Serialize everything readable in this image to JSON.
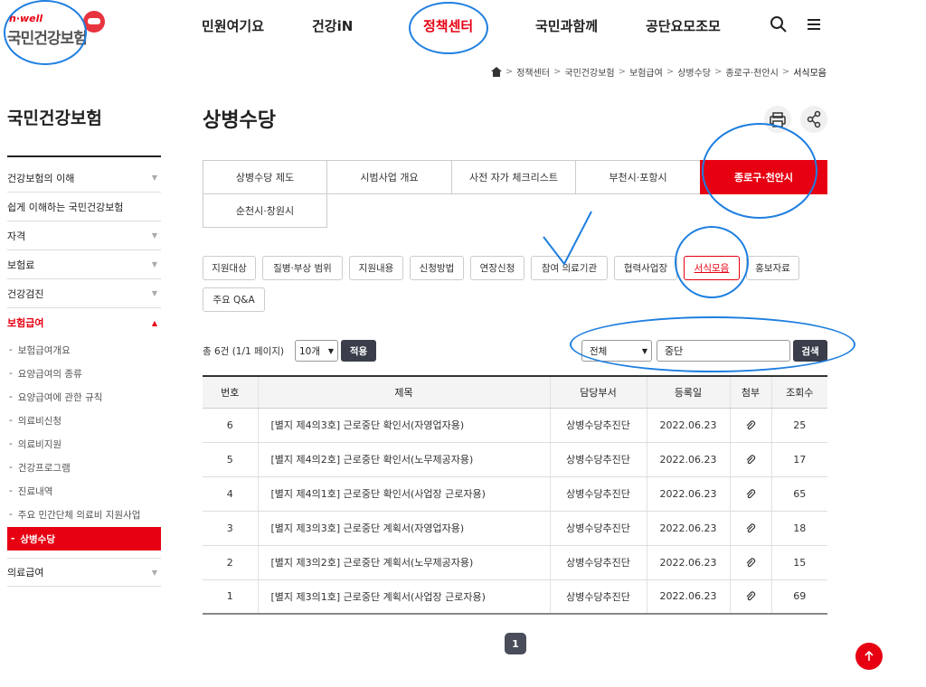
{
  "header": {
    "logo_sub": "h·well",
    "logo_text": "국민건강보험",
    "nav": [
      "민원여기요",
      "건강iN",
      "정책센터",
      "국민과함께",
      "공단요모조모"
    ]
  },
  "breadcrumb": [
    "정책센터",
    "국민건강보험",
    "보험급여",
    "상병수당",
    "종로구·천안시",
    "서식모음"
  ],
  "sidebar": {
    "title": "국민건강보험",
    "items": [
      "건강보험의 이해",
      "쉽게 이해하는 국민건강보험",
      "자격",
      "보험료",
      "건강검진",
      "보험급여"
    ],
    "sub_items": [
      "보험급여개요",
      "요양급여의 종류",
      "요양급여에 관한 규칙",
      "의료비신청",
      "의료비지원",
      "건강프로그램",
      "진료내역",
      "주요 민간단체 의료비 지원사업",
      "상병수당"
    ],
    "last_item": "의료급여"
  },
  "main": {
    "title": "상병수당",
    "tabs": [
      "상병수당 제도",
      "시범사업 개요",
      "사전 자가 체크리스트",
      "부천시·포항시",
      "종로구·천안시",
      "순천시·창원시"
    ],
    "chips": [
      "지원대상",
      "질병·부상 범위",
      "지원내용",
      "신청방법",
      "연장신청",
      "참여 의료기관",
      "협력사업장",
      "서식모음",
      "홍보자료",
      "주요 Q&A"
    ],
    "total": "총 6건",
    "pages": "(1/1 페이지)",
    "per_page": "10개",
    "apply": "적용",
    "search_scope": "전체",
    "search_query": "중단",
    "search_button": "검색",
    "columns": [
      "번호",
      "제목",
      "담당부서",
      "등록일",
      "첨부",
      "조회수"
    ],
    "rows": [
      {
        "no": "6",
        "title": "[별지 제4의3호] 근로중단 확인서(자영업자용)",
        "dept": "상병수당추진단",
        "date": "2022.06.23",
        "views": "25"
      },
      {
        "no": "5",
        "title": "[별지 제4의2호] 근로중단 확인서(노무제공자용)",
        "dept": "상병수당추진단",
        "date": "2022.06.23",
        "views": "17"
      },
      {
        "no": "4",
        "title": "[별지 제4의1호] 근로중단 확인서(사업장 근로자용)",
        "dept": "상병수당추진단",
        "date": "2022.06.23",
        "views": "65"
      },
      {
        "no": "3",
        "title": "[별지 제3의3호] 근로중단 계획서(자영업자용)",
        "dept": "상병수당추진단",
        "date": "2022.06.23",
        "views": "18"
      },
      {
        "no": "2",
        "title": "[별지 제3의2호] 근로중단 계획서(노무제공자용)",
        "dept": "상병수당추진단",
        "date": "2022.06.23",
        "views": "15"
      },
      {
        "no": "1",
        "title": "[별지 제3의1호] 근로중단 계획서(사업장 근로자용)",
        "dept": "상병수당추진단",
        "date": "2022.06.23",
        "views": "69"
      }
    ],
    "page": "1"
  },
  "colors": {
    "accent": "#e60012",
    "annotation": "#1e7fe0",
    "dark_button": "#3a3e4a"
  }
}
